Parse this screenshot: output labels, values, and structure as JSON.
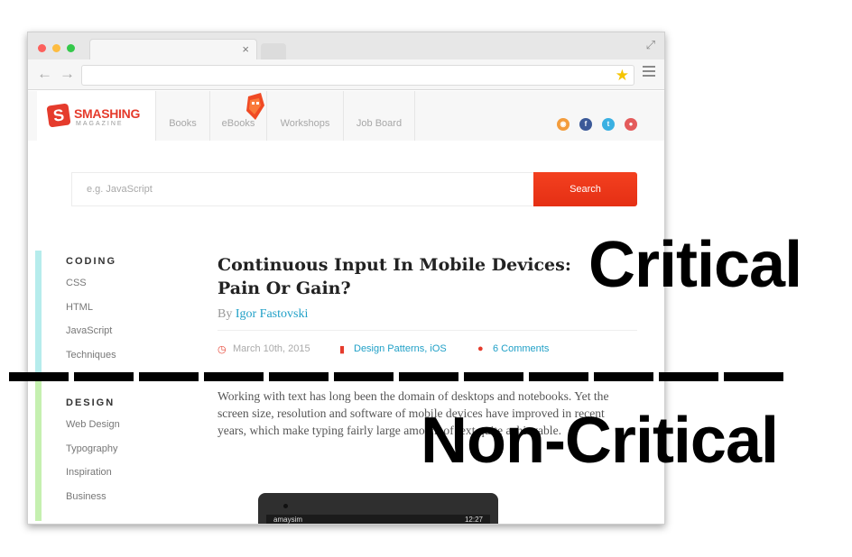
{
  "browser": {
    "tab_close": "×",
    "back_icon": "arrow-left-icon",
    "forward_icon": "arrow-right-icon",
    "bookmark_icon": "star-icon",
    "menu_icon": "hamburger-menu-icon"
  },
  "site": {
    "logo_text": "SMASHING",
    "logo_sub": "MAGAZINE",
    "nav": [
      "Books",
      "eBooks",
      "Workshops",
      "Job Board"
    ],
    "social_icons": [
      "rss-icon",
      "facebook-icon",
      "twitter-icon",
      "googleplus-icon"
    ]
  },
  "search": {
    "placeholder": "e.g. JavaScript",
    "button_label": "Search"
  },
  "sidebar": {
    "coding": {
      "heading": "CODING",
      "links": [
        "CSS",
        "HTML",
        "JavaScript",
        "Techniques"
      ]
    },
    "design": {
      "heading": "DESIGN",
      "links": [
        "Web Design",
        "Typography",
        "Inspiration",
        "Business"
      ]
    }
  },
  "article": {
    "title": "Continuous Input In Mobile Devices: Pain Or Gain?",
    "by": "By",
    "author": "Igor Fastovski",
    "date": "March 10th, 2015",
    "categories": "Design Patterns, iOS",
    "comments": "6 Comments",
    "body": "Working with text has long been the domain of desktops and notebooks. Yet the screen size, resolution and software of mobile devices have improved in recent years, which make typing fairly large amount of text quite achievable."
  },
  "phone": {
    "carrier": "amaysim",
    "time": "12:27"
  },
  "annotations": {
    "critical": "Critical",
    "non_critical": "Non-Critical"
  },
  "colors": {
    "brand": "#e53b2c",
    "link": "#20a0c7",
    "search_button": "#f3401f",
    "coding_bar": "#b6ecec",
    "design_bar": "#c5f0b0"
  }
}
